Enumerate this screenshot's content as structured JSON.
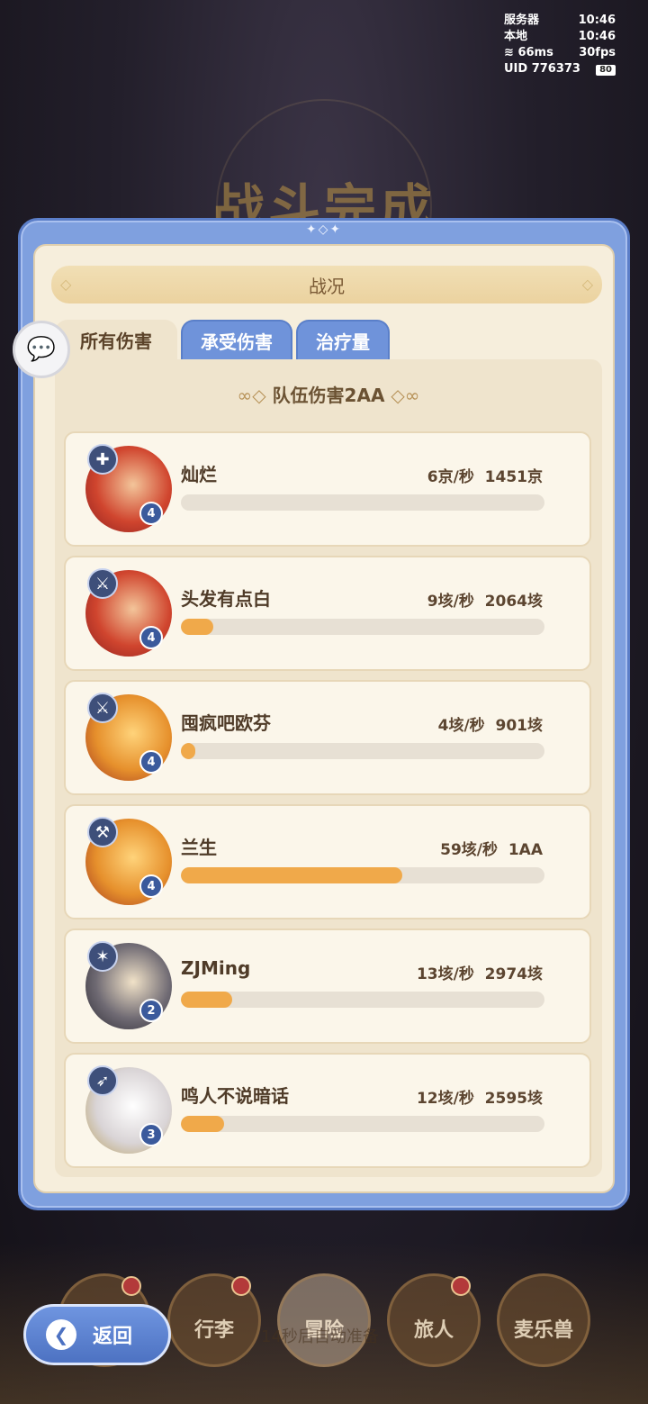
{
  "background": {
    "title": "战斗完成"
  },
  "hud": {
    "server_label": "服务器",
    "server_time": "10:46",
    "local_label": "本地",
    "local_time": "10:46",
    "ping": "66ms",
    "fps": "30fps",
    "uid": "UID 776373",
    "battery": "80"
  },
  "panel": {
    "header": "战况",
    "tabs": [
      {
        "label": "所有伤害",
        "active": true
      },
      {
        "label": "承受伤害",
        "active": false
      },
      {
        "label": "治疗量",
        "active": false
      }
    ],
    "team_total": "队伍伤害2AA",
    "players": [
      {
        "name": "灿烂",
        "stats": "6京/秒  1451京",
        "level": "4",
        "fill": 0.0,
        "class_icon": "shield-cross-icon"
      },
      {
        "name": "头发有点白",
        "stats": "9垓/秒  2064垓",
        "level": "4",
        "fill": 0.09,
        "class_icon": "sword-icon"
      },
      {
        "name": "囤疯吧欧芬",
        "stats": "4垓/秒  901垓",
        "level": "4",
        "fill": 0.04,
        "class_icon": "sword-icon"
      },
      {
        "name": "兰生",
        "stats": "59垓/秒  1AA",
        "level": "4",
        "fill": 0.61,
        "class_icon": "axe-icon"
      },
      {
        "name": "ZJMing",
        "stats": "13垓/秒  2974垓",
        "level": "2",
        "fill": 0.14,
        "class_icon": "star-icon"
      },
      {
        "name": "鸣人不说暗话",
        "stats": "12垓/秒  2595垓",
        "level": "3",
        "fill": 0.12,
        "class_icon": "bow-icon"
      }
    ]
  },
  "bottom_nav": {
    "items": [
      "行李",
      "冒险",
      "旅人",
      "麦乐兽"
    ],
    "prep_text": "14秒后自动准备",
    "back_label": "返回"
  }
}
